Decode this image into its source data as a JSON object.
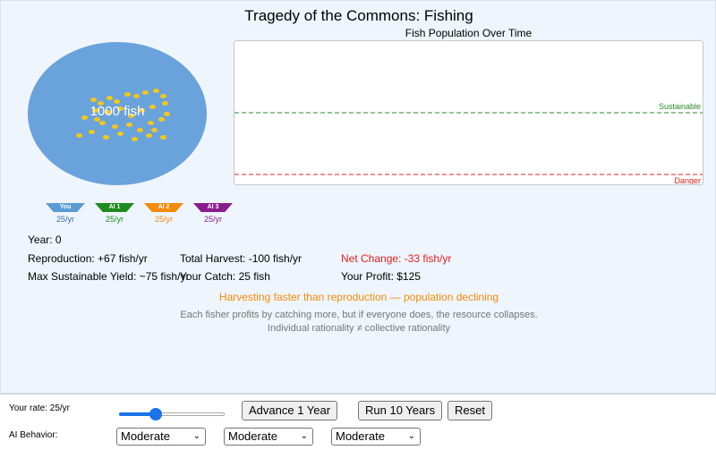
{
  "title": "Tragedy of the Commons: Fishing",
  "lake": {
    "label": "1000 fish",
    "color": "#6aa2dc",
    "fish_color": "#f2c81b"
  },
  "chart": {
    "title": "Fish Population Over Time",
    "sustainable_label": "Sustainable",
    "danger_label": "Danger",
    "sustainable_color": "#2a8a2a",
    "danger_color": "#e02020"
  },
  "fishers": [
    {
      "name": "You",
      "rate": "25/yr",
      "color": "#5b9bd5",
      "text_color": "#2f6ea8"
    },
    {
      "name": "AI 1",
      "rate": "25/yr",
      "color": "#1f8a1f",
      "text_color": "#1f8a1f"
    },
    {
      "name": "AI 2",
      "rate": "25/yr",
      "color": "#f58a0b",
      "text_color": "#f58a0b"
    },
    {
      "name": "AI 3",
      "rate": "25/yr",
      "color": "#8b1d8b",
      "text_color": "#8b1d8b"
    }
  ],
  "stats": {
    "year": "Year: 0",
    "reproduction": "Reproduction: +67 fish/yr",
    "total_harvest": "Total Harvest: -100 fish/yr",
    "net_change": "Net Change: -33 fish/yr",
    "msy": "Max Sustainable Yield: ~75 fish/yr",
    "your_catch": "Your Catch: 25 fish",
    "your_profit": "Your Profit: $125"
  },
  "warning": "Harvesting faster than reproduction — population declining",
  "notes": [
    "Each fisher profits by catching more, but if everyone does, the resource collapses.",
    "Individual rationality ≠ collective rationality"
  ],
  "controls": {
    "rate_label": "Your rate: 25/yr",
    "rate_fraction": 0.33,
    "advance_label": "Advance 1 Year",
    "run10_label": "Run 10 Years",
    "reset_label": "Reset",
    "ai_behavior_label": "AI Behavior:",
    "ai_selects": [
      "Moderate",
      "Moderate",
      "Moderate"
    ]
  }
}
